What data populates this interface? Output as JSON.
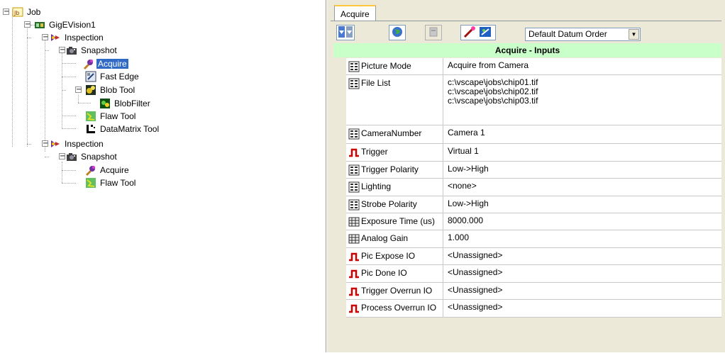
{
  "tree": {
    "items": [
      {
        "label": "Job",
        "icon": "job-icon"
      },
      {
        "label": "GigEVision1",
        "icon": "camera-device-icon"
      },
      {
        "label": "Inspection",
        "icon": "inspection-icon"
      },
      {
        "label": "Snapshot",
        "icon": "snapshot-camera-icon"
      },
      {
        "label": "Acquire",
        "icon": "acquire-icon",
        "selected": true
      },
      {
        "label": "Fast Edge",
        "icon": "fast-edge-icon"
      },
      {
        "label": "Blob Tool",
        "icon": "blob-tool-icon"
      },
      {
        "label": "BlobFilter",
        "icon": "blob-filter-icon"
      },
      {
        "label": "Flaw Tool",
        "icon": "flaw-tool-icon"
      },
      {
        "label": "DataMatrix Tool",
        "icon": "datamatrix-icon"
      },
      {
        "label": "Inspection",
        "icon": "inspection-icon"
      },
      {
        "label": "Snapshot",
        "icon": "snapshot-camera-icon"
      },
      {
        "label": "Acquire",
        "icon": "acquire-icon"
      },
      {
        "label": "Flaw Tool",
        "icon": "flaw-tool-icon"
      }
    ]
  },
  "tabs": [
    {
      "label": "Acquire"
    }
  ],
  "toolbar": {
    "datum_order": "Default Datum Order",
    "buttons": [
      "move-down-icon",
      "globe-icon",
      "disabled-icon",
      "wand-icon"
    ]
  },
  "inputs": {
    "title": "Acquire - Inputs",
    "rows": [
      {
        "name": "Picture Mode",
        "value": "Acquire from Camera",
        "icon": "list-icon"
      },
      {
        "name": "File List",
        "value": "c:\\vscape\\jobs\\chip01.tif\nc:\\vscape\\jobs\\chip02.tif\nc:\\vscape\\jobs\\chip03.tif",
        "icon": "list-icon"
      },
      {
        "name": "CameraNumber",
        "value": "Camera 1",
        "icon": "list-icon"
      },
      {
        "name": "Trigger",
        "value": "Virtual 1",
        "icon": "pulse-icon"
      },
      {
        "name": "Trigger Polarity",
        "value": "Low->High",
        "icon": "list-icon"
      },
      {
        "name": "Lighting",
        "value": "<none>",
        "icon": "list-icon"
      },
      {
        "name": "Strobe Polarity",
        "value": "Low->High",
        "icon": "list-icon"
      },
      {
        "name": "Exposure Time (us)",
        "value": "8000.000",
        "icon": "numeric-icon"
      },
      {
        "name": "Analog Gain",
        "value": "1.000",
        "icon": "numeric-icon"
      },
      {
        "name": "Pic Expose IO",
        "value": "<Unassigned>",
        "icon": "pulse-icon"
      },
      {
        "name": "Pic Done IO",
        "value": "<Unassigned>",
        "icon": "pulse-icon"
      },
      {
        "name": "Trigger Overrun IO",
        "value": "<Unassigned>",
        "icon": "pulse-icon"
      },
      {
        "name": "Process Overrun IO",
        "value": "<Unassigned>",
        "icon": "pulse-icon"
      }
    ]
  },
  "colors": {
    "selection": "#316ac5",
    "header_green": "#c9ffc9",
    "panel_bg": "#ece9d8",
    "pulse_red": "#cc0000"
  }
}
